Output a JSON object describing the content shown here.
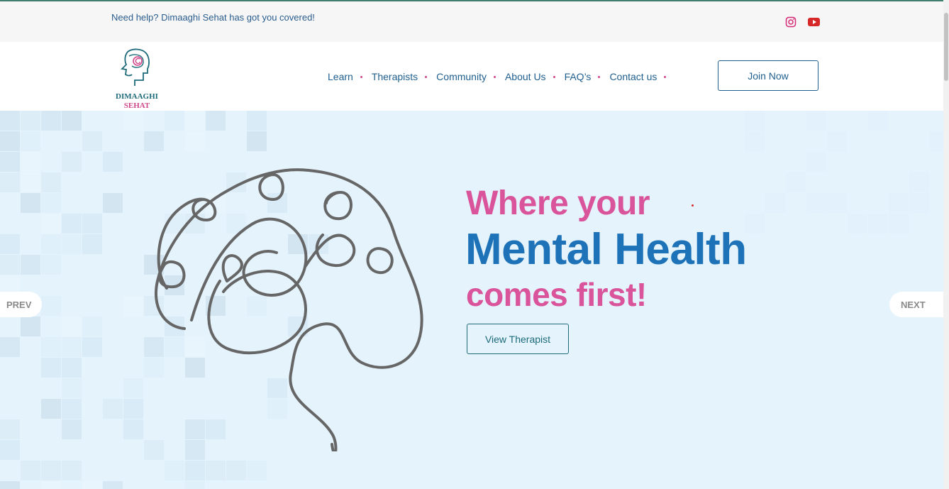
{
  "topbar": {
    "help_text": "Need help? Dimaaghi Sehat has got you covered!",
    "social": [
      {
        "icon": "instagram-icon",
        "color": "#d62976"
      },
      {
        "icon": "youtube-icon",
        "color": "#d62828"
      }
    ]
  },
  "header": {
    "logo": {
      "line1": "DIMAAGHI",
      "line2": "SEHAT"
    },
    "nav": [
      {
        "label": "Learn"
      },
      {
        "label": "Therapists"
      },
      {
        "label": "Community"
      },
      {
        "label": "About Us"
      },
      {
        "label": "FAQ’s"
      },
      {
        "label": "Contact us"
      }
    ],
    "join_label": "Join Now"
  },
  "hero": {
    "line1": "Where your",
    "line2": "Mental Health",
    "line3": "comes first!",
    "cta_label": "View Therapist",
    "prev_label": "PREV",
    "next_label": "NEXT"
  },
  "colors": {
    "accent_pink": "#d9549b",
    "accent_blue": "#1e73b8",
    "teal": "#1d6b7a",
    "hero_bg": "#e5f3fc"
  }
}
